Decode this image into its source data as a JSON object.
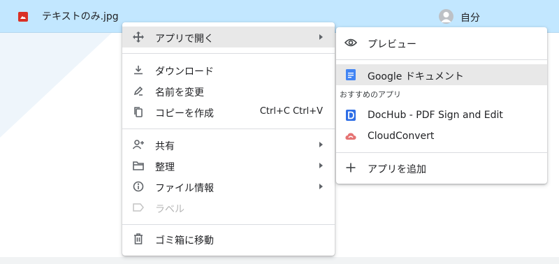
{
  "file": {
    "name": "テキストのみ.jpg",
    "owner": "自分",
    "icon": "image-file-icon"
  },
  "context_menu": {
    "items": [
      {
        "label": "アプリで開く",
        "icon": "open-with-icon",
        "submenu": true,
        "highlighted": true
      },
      {
        "label": "ダウンロード",
        "icon": "download-icon"
      },
      {
        "label": "名前を変更",
        "icon": "rename-pen-icon"
      },
      {
        "label": "コピーを作成",
        "icon": "copy-icon",
        "shortcut": "Ctrl+C Ctrl+V"
      },
      {
        "label": "共有",
        "icon": "person-add-icon",
        "submenu": true
      },
      {
        "label": "整理",
        "icon": "folder-icon",
        "submenu": true
      },
      {
        "label": "ファイル情報",
        "icon": "info-icon",
        "submenu": true
      },
      {
        "label": "ラベル",
        "icon": "label-icon",
        "disabled": true
      },
      {
        "label": "ゴミ箱に移動",
        "icon": "trash-icon"
      }
    ]
  },
  "open_with_submenu": {
    "preview": "プレビュー",
    "google_docs": "Google ドキュメント",
    "suggested_header": "おすすめのアプリ",
    "suggested_apps": [
      "DocHub - PDF Sign and Edit",
      "CloudConvert"
    ],
    "add_app": "アプリを追加"
  },
  "colors": {
    "selected_row": "#c2e7ff",
    "highlight": "#e8e8e8",
    "docs_blue": "#4285f4",
    "image_red": "#d93025",
    "disabled_text": "#b5b5b5"
  }
}
